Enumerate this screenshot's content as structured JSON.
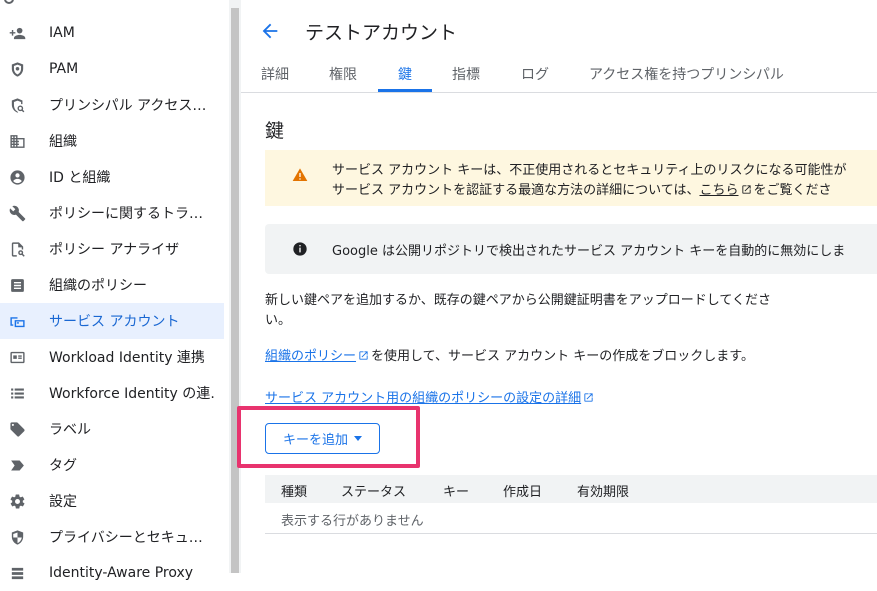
{
  "sidebar": {
    "items": [
      {
        "label": "IAM",
        "icon": "person-add-icon"
      },
      {
        "label": "PAM",
        "icon": "shield-icon"
      },
      {
        "label": "プリンシパル アクセス…",
        "icon": "policy-shield-icon"
      },
      {
        "label": "組織",
        "icon": "domain-icon"
      },
      {
        "label": "ID と組織",
        "icon": "account-circle-icon"
      },
      {
        "label": "ポリシーに関するトラ…",
        "icon": "wrench-icon"
      },
      {
        "label": "ポリシー アナライザ",
        "icon": "document-search-icon"
      },
      {
        "label": "組織のポリシー",
        "icon": "list-document-icon"
      },
      {
        "label": "サービス アカウント",
        "icon": "service-account-icon",
        "active": true
      },
      {
        "label": "Workload Identity 連携",
        "icon": "id-card-icon"
      },
      {
        "label": "Workforce Identity の連…",
        "icon": "list-icon"
      },
      {
        "label": "ラベル",
        "icon": "tag-icon"
      },
      {
        "label": "タグ",
        "icon": "label-arrow-icon"
      },
      {
        "label": "設定",
        "icon": "gear-icon"
      },
      {
        "label": "プライバシーとセキュ…",
        "icon": "privacy-shield-icon"
      },
      {
        "label": "Identity-Aware Proxy",
        "icon": "proxy-icon"
      }
    ]
  },
  "header": {
    "title": "テストアカウント"
  },
  "tabs": [
    {
      "label": "詳細"
    },
    {
      "label": "権限"
    },
    {
      "label": "鍵",
      "active": true
    },
    {
      "label": "指標"
    },
    {
      "label": "ログ"
    },
    {
      "label": "アクセス権を持つプリンシパル"
    }
  ],
  "main": {
    "section_title": "鍵",
    "warning": {
      "line1": "サービス アカウント キーは、不正使用されるとセキュリティ上のリスクになる可能性が",
      "line2_prefix": "サービス アカウントを認証する最適な方法の詳細については、",
      "line2_link": "こちら",
      "line2_suffix": "をご覧くださ"
    },
    "info": {
      "text": "Google は公開リポジトリで検出されたサービス アカウント キーを自動的に無効にしま"
    },
    "description": "新しい鍵ペアを追加するか、既存の鍵ペアから公開鍵証明書をアップロードしてください。",
    "org_policy_link": "組織のポリシー",
    "org_policy_text": "を使用して、サービス アカウント キーの作成をブロックします。",
    "org_policy_details_link": "サービス アカウント用の組織のポリシーの設定の詳細",
    "add_key_button": "キーを追加"
  },
  "table": {
    "columns": [
      "種類",
      "ステータス",
      "キー",
      "作成日",
      "有効期限"
    ],
    "empty_text": "表示する行がありません"
  },
  "colors": {
    "accent": "#1a73e8",
    "highlight": "#e8336e",
    "warning_bg": "#fef7e0",
    "warning_icon": "#e37400"
  }
}
